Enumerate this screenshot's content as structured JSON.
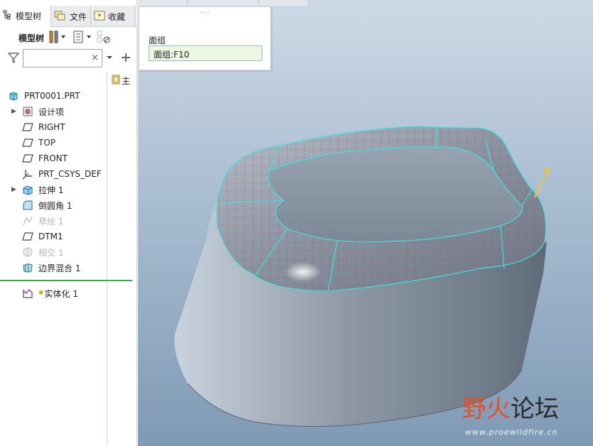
{
  "tabs": [
    {
      "label": "模型树",
      "icon": "model-tree-icon"
    },
    {
      "label": "文件",
      "icon": "folder-icon"
    },
    {
      "label": "收藏",
      "icon": "favorites-icon"
    }
  ],
  "toolbar": {
    "label": "模型树"
  },
  "filter": {
    "value": "",
    "clear": "×"
  },
  "column": {
    "header": "主"
  },
  "tree": [
    {
      "label": "PRT0001.PRT",
      "icon": "part-icon",
      "expander": ""
    },
    {
      "label": "设计项",
      "icon": "design-items-icon",
      "expander": "▶"
    },
    {
      "label": "RIGHT",
      "icon": "datum-plane-icon",
      "expander": ""
    },
    {
      "label": "TOP",
      "icon": "datum-plane-icon",
      "expander": ""
    },
    {
      "label": "FRONT",
      "icon": "datum-plane-icon",
      "expander": ""
    },
    {
      "label": "PRT_CSYS_DEF",
      "icon": "csys-icon",
      "expander": ""
    },
    {
      "label": "拉伸 1",
      "icon": "extrude-icon",
      "expander": "▶"
    },
    {
      "label": "倒圆角 1",
      "icon": "round-icon",
      "expander": ""
    },
    {
      "label": "草绘 1",
      "icon": "sketch-icon",
      "expander": "",
      "dimmed": true
    },
    {
      "label": "DTM1",
      "icon": "datum-plane-icon",
      "expander": ""
    },
    {
      "label": "相交 1",
      "icon": "intersect-icon",
      "expander": "",
      "dimmed": true
    },
    {
      "label": "边界混合 1",
      "icon": "boundary-blend-icon",
      "expander": ""
    },
    {
      "label": "实体化 1",
      "icon": "solidify-icon",
      "expander": ""
    }
  ],
  "popup": {
    "grip": "....",
    "label": "面组",
    "value": "面组:F10"
  },
  "watermark": {
    "text_a": "野火",
    "text_b": "论坛",
    "url": "www.proewildfire.cn"
  },
  "colors": {
    "accent_green": "#32b043",
    "edge_cyan": "#3fe0e6",
    "popup_bg": "#ebf7e1"
  }
}
